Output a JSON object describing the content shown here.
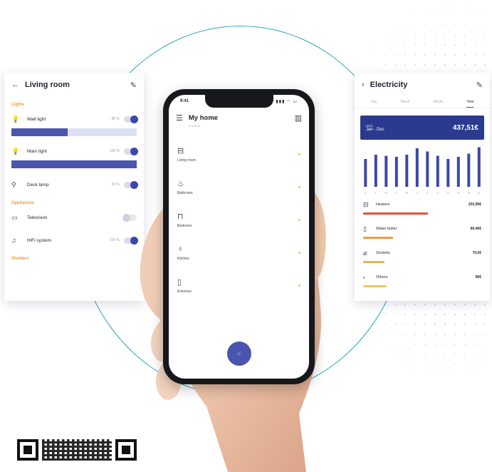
{
  "left_card": {
    "title": "Living room",
    "sections": {
      "lights": "Lights",
      "appliances": "Appliances",
      "shutters": "Shutters"
    },
    "devices": [
      {
        "name": "Wall light",
        "value": "80 %",
        "on": true,
        "level": 0.45
      },
      {
        "name": "Main light",
        "value": "100 %",
        "on": true,
        "level": 1.0
      },
      {
        "name": "Desk lamp",
        "value": "60 %",
        "on": true
      },
      {
        "name": "Television",
        "value": "",
        "on": false
      },
      {
        "name": "HiFi system",
        "value": "100 %",
        "on": true
      }
    ]
  },
  "right_card": {
    "title": "Electricity",
    "tabs": [
      "Day",
      "Week",
      "Month",
      "Year"
    ],
    "active_tab": "Year",
    "banner": {
      "year": "2021",
      "range": "Jan - Dec",
      "total": "437,51€"
    },
    "chart_data": {
      "type": "bar",
      "categories": [
        "J",
        "F",
        "M",
        "A",
        "M",
        "J",
        "J",
        "A",
        "S",
        "O",
        "N",
        "D"
      ],
      "values": [
        52,
        60,
        58,
        56,
        60,
        72,
        66,
        58,
        52,
        56,
        62,
        74
      ],
      "ylim": [
        0,
        80
      ]
    },
    "consumers": [
      {
        "name": "Heaters",
        "value": "202,99€",
        "color": "#e8502f",
        "share": 0.55
      },
      {
        "name": "Water boiler",
        "value": "80,46€",
        "color": "#f29a3c",
        "share": 0.25
      },
      {
        "name": "Sockets",
        "value": "70,5€",
        "color": "#f2b43c",
        "share": 0.18
      },
      {
        "name": "Others",
        "value": "96€",
        "color": "#f2c94c",
        "share": 0.2
      }
    ]
  },
  "phone": {
    "time": "9:41",
    "title": "My home",
    "subtitle": "3 rooms",
    "rooms": [
      {
        "name": "Living room",
        "icon": "sofa-icon"
      },
      {
        "name": "Bathroom",
        "icon": "bath-icon"
      },
      {
        "name": "Bedroom",
        "icon": "bed-icon"
      },
      {
        "name": "Kitchen",
        "icon": "cooking-pot-icon"
      },
      {
        "name": "Entrance",
        "icon": "door-icon"
      }
    ]
  },
  "colors": {
    "accent": "#3d47a8",
    "banner": "#2b3a8f",
    "ring": "#27a6b8",
    "warning": "#f29a3c"
  }
}
